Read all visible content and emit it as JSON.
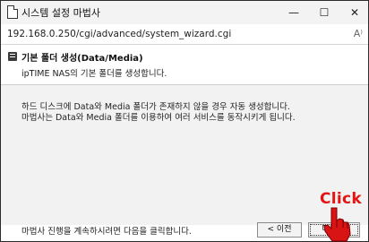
{
  "window": {
    "title": "시스템 설정 마법사",
    "minimize_glyph": "—",
    "maximize_glyph": "☐",
    "close_glyph": "✕"
  },
  "address_bar": {
    "url": "192.168.0.250/cgi/advanced/system_wizard.cgi",
    "reader_icon": "A⁾"
  },
  "header": {
    "icon": "book-icon",
    "title": "기본 폴더 생성(Data/Media)",
    "subtitle": "ipTIME NAS의 기본 폴더를 생성합니다."
  },
  "body": {
    "lines": [
      "하드 디스크에 Data와 Media 폴더가 존재하지 않을 경우 자동 생성합니다.",
      "마법사는 Data와 Media 폴더를 이용하여 여러 서비스를 동작시키게 됩니다."
    ],
    "footer_text": "마법사 진행을 계속하시려면 다음을 클릭합니다."
  },
  "buttons": {
    "prev": "< 이전",
    "next": "다음 >"
  },
  "annotation": {
    "label": "Click",
    "color": "#e31414",
    "icon": "pointing-hand-icon"
  }
}
